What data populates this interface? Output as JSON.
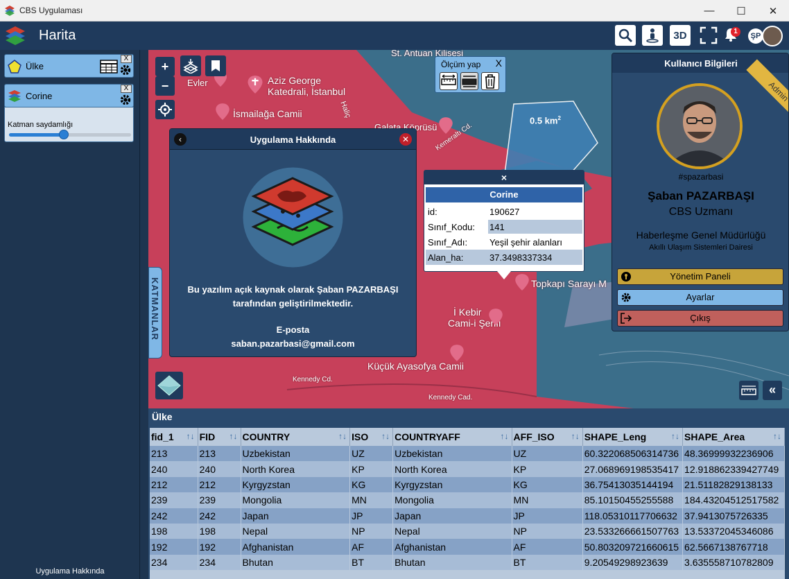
{
  "window": {
    "title": "CBS Uygulaması"
  },
  "header": {
    "title": "Harita",
    "btn_3d": "3D",
    "notif_count": "1",
    "user_initials": "ŞP"
  },
  "sidebar": {
    "layers": [
      {
        "name": "Ülke",
        "close": "X"
      },
      {
        "name": "Corine",
        "close": "X"
      }
    ],
    "transparency_label": "Katman saydamlığı",
    "transparency_value": 0.45,
    "about_link": "Uygulama Hakkında"
  },
  "map": {
    "labels": {
      "antuan": "St. Antuan Kilisesi",
      "aziz1": "Aziz George",
      "aziz2": "Katedrali, İstanbul",
      "levler": "Evler",
      "ismailaga": "İsmailağa Camii",
      "halic": "Haliç",
      "galata": "Galata Köprüsü",
      "kemeralti": "Kemeraltı Cd.",
      "topkapi": "Topkapı Sarayı M",
      "kebir1": "İ Kebir",
      "kebir2": "Cami-i Şerifi",
      "kucuk": "Küçük Ayasofya Camii",
      "kennedy1": "Kennedy Cd.",
      "kennedy2": "Kennedy Cad.",
      "area": "0.5 km",
      "area_sup": "2"
    },
    "katmanlar": "KATMANLAR",
    "zoom_in": "+",
    "zoom_out": "−",
    "collapse": "«"
  },
  "measure": {
    "title": "Ölçüm yap",
    "close": "X"
  },
  "about": {
    "title": "Uygulama Hakkında",
    "line1": "Bu yazılım açık kaynak olarak Şaban PAZARBAŞI",
    "line2": "tarafından geliştirilmektedir.",
    "email_label": "E-posta",
    "email": "saban.pazarbasi@gmail.com"
  },
  "popup": {
    "close": "×",
    "title": "Corine",
    "rows": [
      {
        "k": "id:",
        "v": "190627"
      },
      {
        "k": "Sınıf_Kodu:",
        "v": "141"
      },
      {
        "k": "Sınıf_Adı:",
        "v": "Yeşil şehir alanları"
      },
      {
        "k": "Alan_ha:",
        "v": "37.3498337334"
      }
    ]
  },
  "user": {
    "panel_title": "Kullanıcı Bilgileri",
    "badge": "Admin",
    "handle": "#spazarbasi",
    "name": "Şaban PAZARBAŞI",
    "role": "CBS Uzmanı",
    "org": "Haberleşme Genel Müdürlüğü",
    "dept": "Akıllı Ulaşım Sistemleri Dairesi",
    "buttons": [
      {
        "label": "Yönetim Paneli",
        "color": "#c7a43a"
      },
      {
        "label": "Ayarlar",
        "color": "#7fb7e6"
      },
      {
        "label": "Çıkış",
        "color": "#c0605c"
      }
    ]
  },
  "table": {
    "title": "Ülke",
    "columns": [
      "fid_1",
      "FID",
      "COUNTRY",
      "ISO",
      "COUNTRYAFF",
      "AFF_ISO",
      "SHAPE_Leng",
      "SHAPE_Area"
    ],
    "rows": [
      [
        "213",
        "213",
        "Uzbekistan",
        "UZ",
        "Uzbekistan",
        "UZ",
        "60.322068506314736",
        "48.36999932236906"
      ],
      [
        "240",
        "240",
        "North Korea",
        "KP",
        "North Korea",
        "KP",
        "27.068969198535417",
        "12.918862339427749"
      ],
      [
        "212",
        "212",
        "Kyrgyzstan",
        "KG",
        "Kyrgyzstan",
        "KG",
        "36.75413035144194",
        "21.51182829138133"
      ],
      [
        "239",
        "239",
        "Mongolia",
        "MN",
        "Mongolia",
        "MN",
        "85.10150455255588",
        "184.43204512517582"
      ],
      [
        "242",
        "242",
        "Japan",
        "JP",
        "Japan",
        "JP",
        "118.05310117706632",
        "37.9413075726335"
      ],
      [
        "198",
        "198",
        "Nepal",
        "NP",
        "Nepal",
        "NP",
        "23.533266661507763",
        "13.53372045346086"
      ],
      [
        "192",
        "192",
        "Afghanistan",
        "AF",
        "Afghanistan",
        "AF",
        "50.803209721660615",
        "62.5667138767718"
      ],
      [
        "234",
        "234",
        "Bhutan",
        "BT",
        "Bhutan",
        "BT",
        "9.20549298923639",
        "3.635558710782809"
      ]
    ]
  }
}
